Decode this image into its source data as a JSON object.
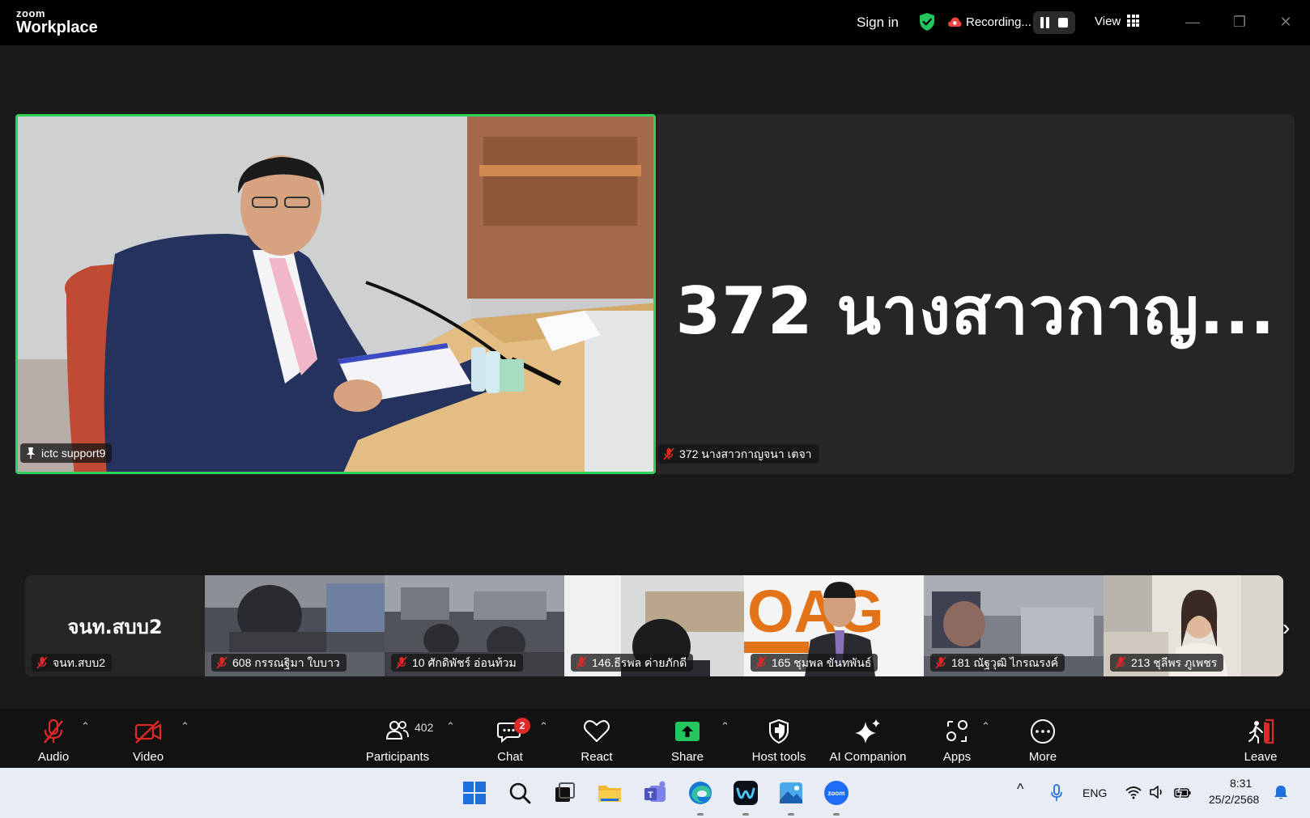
{
  "titlebar": {
    "logo_top": "zoom",
    "logo_bottom": "Workplace",
    "sign_in": "Sign in",
    "recording": "Recording...",
    "view": "View"
  },
  "tiles": {
    "speaker_name": "ictc support9",
    "second_big": "372 นางสาวกาญ...",
    "second_name": "372 นางสาวกาญจนา เตจา"
  },
  "filmstrip": [
    {
      "name": "จนท.สบบ2",
      "text": "จนท.สบบ2"
    },
    {
      "name": "608 กรรณฐิมา ใบบาว"
    },
    {
      "name": "10 ศักดิพัชร์ อ่อนท้วม"
    },
    {
      "name": "146.ธีรพล ค่ายภักดี"
    },
    {
      "name": "165 ชุมพล ขันทพันธ์"
    },
    {
      "name": "181 ณัฐวุฒิ  ไกรณรงค์"
    },
    {
      "name": "213 ชุลีพร ภูเพชร"
    }
  ],
  "toolbar": {
    "audio": "Audio",
    "video": "Video",
    "participants": "Participants",
    "participants_count": "402",
    "chat": "Chat",
    "chat_badge": "2",
    "react": "React",
    "share": "Share",
    "host_tools": "Host tools",
    "ai_companion": "AI Companion",
    "apps": "Apps",
    "more": "More",
    "leave": "Leave"
  },
  "taskbar": {
    "lang": "ENG",
    "time": "8:31",
    "date": "25/2/2568"
  },
  "colors": {
    "active_speaker_border": "#2ed159",
    "muted_red": "#e02828",
    "share_green": "#22c55e",
    "leave_red": "#e02828"
  }
}
